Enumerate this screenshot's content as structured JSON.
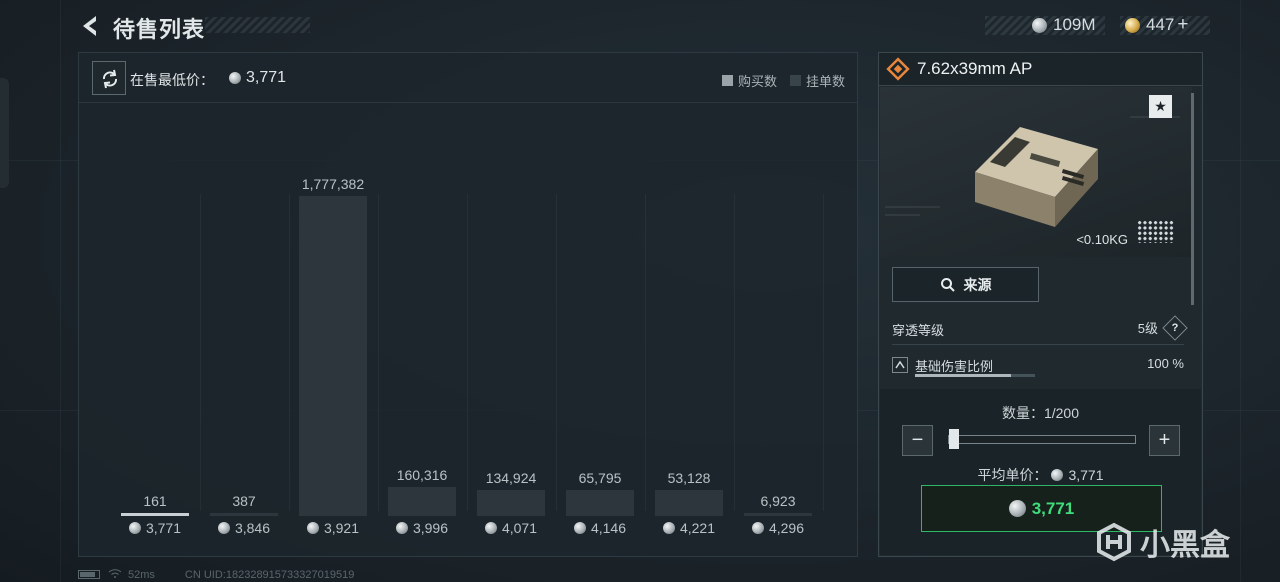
{
  "header": {
    "title": "待售列表",
    "silver_amount": "109M",
    "gold_amount": "447"
  },
  "chart_panel": {
    "min_price_label": "在售最低价：",
    "min_price_value": "3,771",
    "legend_buy": "购买数",
    "legend_list": "挂单数"
  },
  "chart_data": {
    "type": "bar",
    "categories": [
      "3,771",
      "3,846",
      "3,921",
      "3,996",
      "4,071",
      "4,146",
      "4,221",
      "4,296"
    ],
    "series": [
      {
        "name": "挂单数",
        "values": [
          161,
          387,
          1777382,
          160316,
          134924,
          65795,
          53128,
          6923
        ]
      }
    ],
    "value_labels": [
      "161",
      "387",
      "1,777,382",
      "160,316",
      "134,924",
      "65,795",
      "53,128",
      "6,923"
    ],
    "ylim": [
      0,
      1777382
    ]
  },
  "item": {
    "name": "7.62x39mm AP",
    "favorite_icon": "★",
    "weight": "<0.10KG",
    "source_button": "来源",
    "penetration_label": "穿透等级",
    "penetration_value": "5级",
    "help_icon": "?",
    "damage_label": "基础伤害比例",
    "damage_value": "100 %",
    "damage_fill_fraction": 0.8,
    "quantity_label": "数量：1/200",
    "minus": "−",
    "plus": "+",
    "quantity_fraction": 0.005,
    "avg_price_label": "平均单价：",
    "avg_price_value": "3,771",
    "total_price": "3,771"
  },
  "footer": {
    "ping": "52ms",
    "uid": "CN UID:182328915733327019519"
  },
  "watermark": "小黑盒",
  "colors": {
    "accent_green": "#3fdc7c",
    "bar": "#2c363c",
    "item_icon": "#e8863c"
  }
}
